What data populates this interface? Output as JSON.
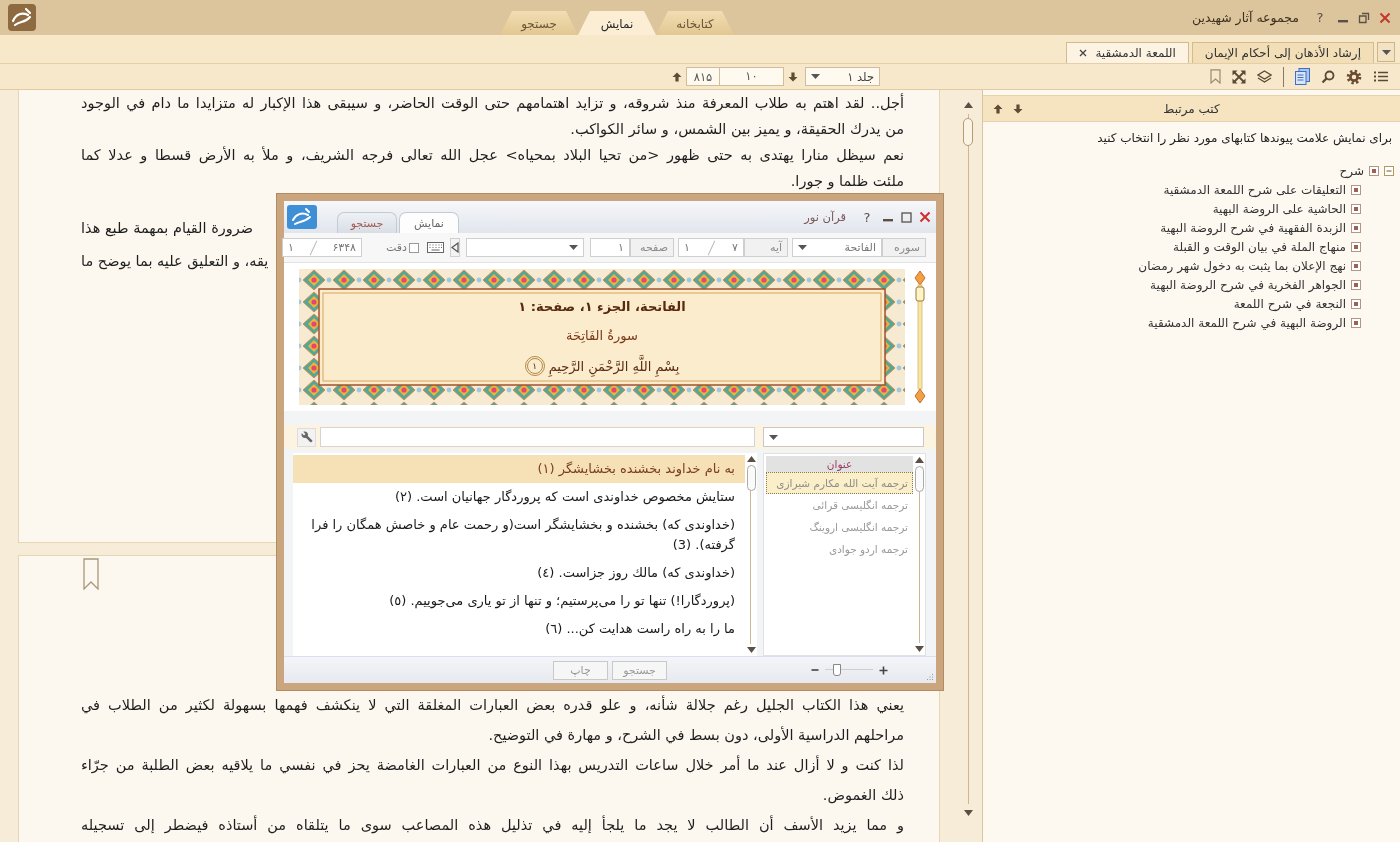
{
  "window": {
    "title": "مجموعه آثار شهیدین",
    "help": "?"
  },
  "main_tabs": [
    {
      "label": "کتابخانه",
      "selected": false
    },
    {
      "label": "نمایش",
      "selected": true
    },
    {
      "label": "جستجو",
      "selected": false
    }
  ],
  "document_tabs": [
    {
      "label": "إرشاد الأذهان إلى أحكام الإيمان",
      "selected": false,
      "closable": false
    },
    {
      "label": "اللمعة الدمشقية",
      "selected": true,
      "closable": true
    }
  ],
  "toolbar": {
    "volume": "جلد ۱",
    "page": "۱۰",
    "page_count": "۸۱۵"
  },
  "pages": [
    {
      "bookmark": false,
      "lines": [
        {
          "kind": "justified",
          "text": "أجل.. لقد اهتم به طلاب المعرفة منذ شروقه، و تزايد اهتمامهم حتى الوقت الحاضر، و سيبقى هذا الإكبار له متزايدا ما دام في الوجود"
        },
        {
          "kind": "end",
          "text": "من يدرك الحقيقة، و يميز بين الشمس، و سائر الكواكب."
        },
        {
          "kind": "justified",
          "text": "نعم سيظل منارا يهتدى به حتى ظهور <من تحيا البلاد بمحياه> عجل الله تعالى فرجه الشريف، و ملأ به الأرض قسطا و عدلا كما"
        },
        {
          "kind": "end",
          "text": "ملئت ظلما و جورا."
        },
        {
          "kind": "tail",
          "text": "ضرورة القيام بمهمة طبع هذا"
        },
        {
          "kind": "tail",
          "text": "يقه، و التعليق عليه بما يوضح ما"
        }
      ]
    },
    {
      "bookmark": true,
      "lines": [
        {
          "kind": "justified",
          "text": "يعني هذا الكتاب الجليل رغم جلالة شأنه، و علو قدره بعض العبارات المغلقة التي لا ينكشف فهمها بسهولة لكثير من الطلاب في"
        },
        {
          "kind": "end",
          "text": "مراحلهم الدراسية الأولى، دون بسط في الشرح، و مهارة في التوضيح."
        },
        {
          "kind": "justified",
          "text": "لذا كنت و لا أزال عند ما أمر خلال ساعات التدريس بهذا النوع من العبارات الغامضة يحز في نفسي ما يلاقيه بعض الطلبة من جرّاء"
        },
        {
          "kind": "end",
          "text": "ذلك الغموض."
        },
        {
          "kind": "justified",
          "text": "و مما يزيد الأسف أن الطالب لا يجد ما يلجأ إليه في تذليل هذه المصاعب سوى ما يتلقاه من أستاذه فيضطر إلى تسجيله"
        }
      ]
    }
  ],
  "related_books": {
    "title": "کتب مرتبط",
    "hint": "برای نمایش علامت پیوندها کتابهای مورد نظر را انتخاب کنید",
    "tree": [
      {
        "label": "شرح",
        "checked": true,
        "expanded": true,
        "children": [
          {
            "label": "التعليقات على شرح اللمعة الدمشقية",
            "checked": true
          },
          {
            "label": "الحاشية على الروضة البهية",
            "checked": true
          },
          {
            "label": "الزبدة الفقهية في شرح الروضة البهية",
            "checked": true
          },
          {
            "label": "منهاج الملة في بيان الوقت و القبلة",
            "checked": true
          },
          {
            "label": "نهج الإعلان بما يثبت به دخول شهر رمضان",
            "checked": true
          },
          {
            "label": "الجواهر الفخرية في شرح الروضة البهية",
            "checked": true
          },
          {
            "label": "النجعة في شرح اللمعة",
            "checked": true
          },
          {
            "label": "الروضة البهية في شرح اللمعة الدمشقية",
            "checked": true
          }
        ]
      }
    ]
  },
  "quran_window": {
    "title": "قرآن نور",
    "help": "?",
    "tabs": [
      {
        "label": "نمایش",
        "selected": true
      },
      {
        "label": "جستجو",
        "selected": false
      }
    ],
    "toolbar": {
      "sura_label": "سوره",
      "sura": "الفاتحة",
      "aya_label": "آیه",
      "aya_count": "۷",
      "aya": "۱",
      "page_label": "صفحه",
      "page": "۱",
      "exact": {
        "label": "دقت",
        "checked": false
      },
      "verse_count": "۶۳۴۸",
      "verse": "۱"
    },
    "header": {
      "heading": "الفاتحة، الجزء ۱، صفحة: ۱",
      "sura_name": "سورةُ الفَاتِحَة",
      "basmala": "بِسْمِ اللَّهِ الرَّحْمَنِ الرَّحِيمِ",
      "aya_number": "۱"
    },
    "verses": [
      {
        "text": "به نام خداوند بخشنده بخشایشگر (۱)",
        "selected": true
      },
      {
        "text": "ستایش مخصوص خداوندی است که پروردگار جهانیان است. (۲)",
        "selected": false
      },
      {
        "text": "(خداوندی که) بخشنده و بخشایشگر است(و رحمت عام و خاصش همگان را فرا گرفته). (3)",
        "selected": false
      },
      {
        "text": "(خداوندی که) مالك روز جزاست. (٤)",
        "selected": false
      },
      {
        "text": "(پروردگارا!) تنها تو را می‌پرستیم؛ و تنها از تو یاری می‌جوییم. (٥)",
        "selected": false
      },
      {
        "text": "ما را به راه راست هدایت کن... (٦)",
        "selected": false
      }
    ],
    "translations": {
      "header": "عنوان",
      "items": [
        {
          "label": "ترجمه آیت الله مکارم شیرازی",
          "selected": true
        },
        {
          "label": "ترجمه انگلیسی قرائی",
          "selected": false
        },
        {
          "label": "ترجمه انگلیسی اروینگ",
          "selected": false
        },
        {
          "label": "ترجمه اردو جوادی",
          "selected": false
        }
      ]
    },
    "buttons": [
      {
        "label": "جستجو",
        "disabled": true
      },
      {
        "label": "چاپ",
        "disabled": true
      }
    ],
    "zoom": {
      "level": 0.2
    }
  }
}
